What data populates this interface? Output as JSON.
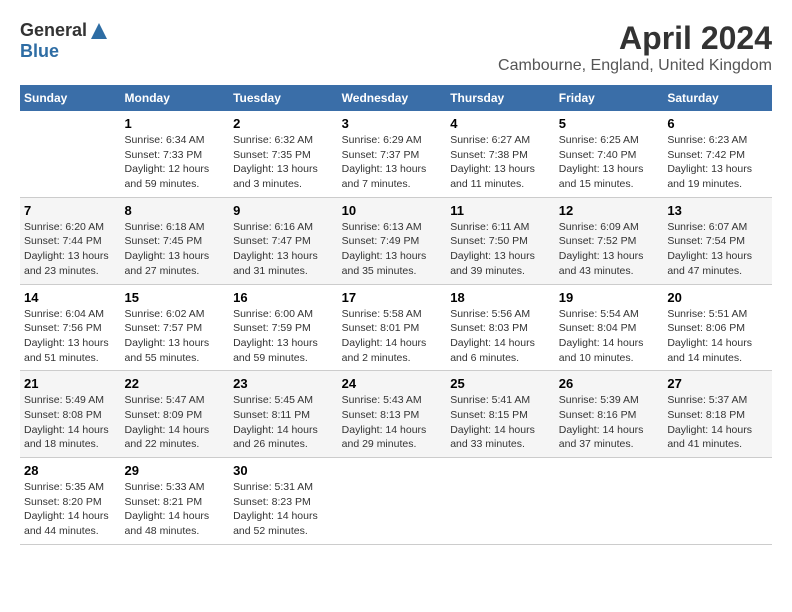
{
  "logo": {
    "general": "General",
    "blue": "Blue"
  },
  "title": "April 2024",
  "location": "Cambourne, England, United Kingdom",
  "days_header": [
    "Sunday",
    "Monday",
    "Tuesday",
    "Wednesday",
    "Thursday",
    "Friday",
    "Saturday"
  ],
  "weeks": [
    [
      {
        "day": "",
        "info": ""
      },
      {
        "day": "1",
        "info": "Sunrise: 6:34 AM\nSunset: 7:33 PM\nDaylight: 12 hours\nand 59 minutes."
      },
      {
        "day": "2",
        "info": "Sunrise: 6:32 AM\nSunset: 7:35 PM\nDaylight: 13 hours\nand 3 minutes."
      },
      {
        "day": "3",
        "info": "Sunrise: 6:29 AM\nSunset: 7:37 PM\nDaylight: 13 hours\nand 7 minutes."
      },
      {
        "day": "4",
        "info": "Sunrise: 6:27 AM\nSunset: 7:38 PM\nDaylight: 13 hours\nand 11 minutes."
      },
      {
        "day": "5",
        "info": "Sunrise: 6:25 AM\nSunset: 7:40 PM\nDaylight: 13 hours\nand 15 minutes."
      },
      {
        "day": "6",
        "info": "Sunrise: 6:23 AM\nSunset: 7:42 PM\nDaylight: 13 hours\nand 19 minutes."
      }
    ],
    [
      {
        "day": "7",
        "info": "Sunrise: 6:20 AM\nSunset: 7:44 PM\nDaylight: 13 hours\nand 23 minutes."
      },
      {
        "day": "8",
        "info": "Sunrise: 6:18 AM\nSunset: 7:45 PM\nDaylight: 13 hours\nand 27 minutes."
      },
      {
        "day": "9",
        "info": "Sunrise: 6:16 AM\nSunset: 7:47 PM\nDaylight: 13 hours\nand 31 minutes."
      },
      {
        "day": "10",
        "info": "Sunrise: 6:13 AM\nSunset: 7:49 PM\nDaylight: 13 hours\nand 35 minutes."
      },
      {
        "day": "11",
        "info": "Sunrise: 6:11 AM\nSunset: 7:50 PM\nDaylight: 13 hours\nand 39 minutes."
      },
      {
        "day": "12",
        "info": "Sunrise: 6:09 AM\nSunset: 7:52 PM\nDaylight: 13 hours\nand 43 minutes."
      },
      {
        "day": "13",
        "info": "Sunrise: 6:07 AM\nSunset: 7:54 PM\nDaylight: 13 hours\nand 47 minutes."
      }
    ],
    [
      {
        "day": "14",
        "info": "Sunrise: 6:04 AM\nSunset: 7:56 PM\nDaylight: 13 hours\nand 51 minutes."
      },
      {
        "day": "15",
        "info": "Sunrise: 6:02 AM\nSunset: 7:57 PM\nDaylight: 13 hours\nand 55 minutes."
      },
      {
        "day": "16",
        "info": "Sunrise: 6:00 AM\nSunset: 7:59 PM\nDaylight: 13 hours\nand 59 minutes."
      },
      {
        "day": "17",
        "info": "Sunrise: 5:58 AM\nSunset: 8:01 PM\nDaylight: 14 hours\nand 2 minutes."
      },
      {
        "day": "18",
        "info": "Sunrise: 5:56 AM\nSunset: 8:03 PM\nDaylight: 14 hours\nand 6 minutes."
      },
      {
        "day": "19",
        "info": "Sunrise: 5:54 AM\nSunset: 8:04 PM\nDaylight: 14 hours\nand 10 minutes."
      },
      {
        "day": "20",
        "info": "Sunrise: 5:51 AM\nSunset: 8:06 PM\nDaylight: 14 hours\nand 14 minutes."
      }
    ],
    [
      {
        "day": "21",
        "info": "Sunrise: 5:49 AM\nSunset: 8:08 PM\nDaylight: 14 hours\nand 18 minutes."
      },
      {
        "day": "22",
        "info": "Sunrise: 5:47 AM\nSunset: 8:09 PM\nDaylight: 14 hours\nand 22 minutes."
      },
      {
        "day": "23",
        "info": "Sunrise: 5:45 AM\nSunset: 8:11 PM\nDaylight: 14 hours\nand 26 minutes."
      },
      {
        "day": "24",
        "info": "Sunrise: 5:43 AM\nSunset: 8:13 PM\nDaylight: 14 hours\nand 29 minutes."
      },
      {
        "day": "25",
        "info": "Sunrise: 5:41 AM\nSunset: 8:15 PM\nDaylight: 14 hours\nand 33 minutes."
      },
      {
        "day": "26",
        "info": "Sunrise: 5:39 AM\nSunset: 8:16 PM\nDaylight: 14 hours\nand 37 minutes."
      },
      {
        "day": "27",
        "info": "Sunrise: 5:37 AM\nSunset: 8:18 PM\nDaylight: 14 hours\nand 41 minutes."
      }
    ],
    [
      {
        "day": "28",
        "info": "Sunrise: 5:35 AM\nSunset: 8:20 PM\nDaylight: 14 hours\nand 44 minutes."
      },
      {
        "day": "29",
        "info": "Sunrise: 5:33 AM\nSunset: 8:21 PM\nDaylight: 14 hours\nand 48 minutes."
      },
      {
        "day": "30",
        "info": "Sunrise: 5:31 AM\nSunset: 8:23 PM\nDaylight: 14 hours\nand 52 minutes."
      },
      {
        "day": "",
        "info": ""
      },
      {
        "day": "",
        "info": ""
      },
      {
        "day": "",
        "info": ""
      },
      {
        "day": "",
        "info": ""
      }
    ]
  ]
}
